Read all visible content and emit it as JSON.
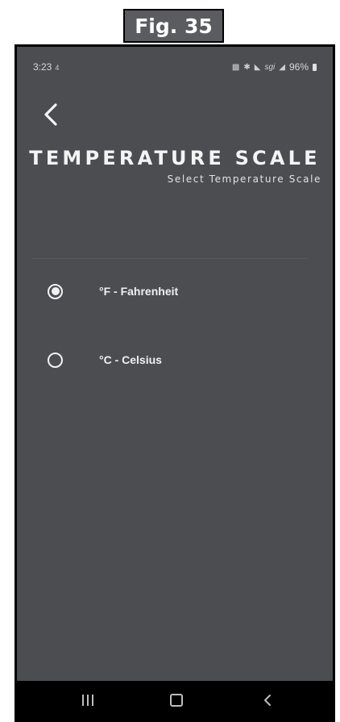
{
  "figure": {
    "label": "Fig. 35"
  },
  "status_bar": {
    "time": "3:23",
    "time_icon": "4",
    "icons": [
      "vibrate-icon",
      "bluetooth-icon",
      "signal-icon",
      "sgi-icon",
      "cellular-icon"
    ],
    "sgi_text": "sgi",
    "battery": "96%"
  },
  "header": {
    "back_icon": "chevron-left-icon",
    "title": "TEMPERATURE SCALE",
    "subtitle": "Select Temperature Scale"
  },
  "options": [
    {
      "label": "°F - Fahrenheit",
      "selected": true
    },
    {
      "label": "°C - Celsius",
      "selected": false
    }
  ],
  "nav_bar": {
    "recents_icon": "recents-icon",
    "home_icon": "home-icon",
    "back_icon": "back-icon"
  },
  "colors": {
    "screen_bg": "#4b4d51",
    "figure_label_bg": "#5b5c5f",
    "nav_bar_bg": "#000000",
    "text": "#f0f0f0"
  }
}
